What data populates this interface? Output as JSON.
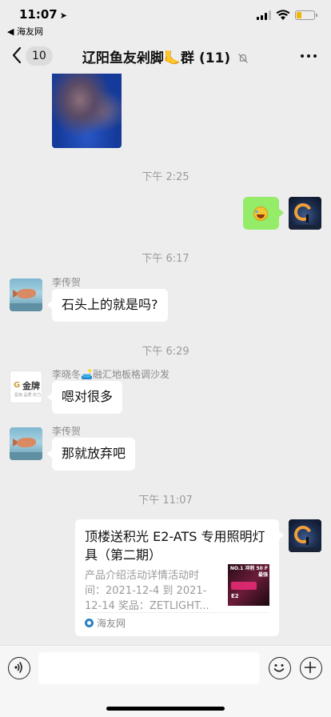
{
  "status_bar": {
    "time": "11:07",
    "back_app": "◀ 海友网",
    "battery_level": 0.28,
    "battery_color": "#f2b600"
  },
  "nav": {
    "back_count": "10",
    "title": "辽阳鱼友剁脚🦶群 (11)",
    "muted": true
  },
  "messages": [
    {
      "type": "image",
      "side": "left"
    },
    {
      "type": "timestamp",
      "text": "下午 2:25"
    },
    {
      "type": "emoji",
      "side": "right",
      "emoji": "laughing-tears-icon"
    },
    {
      "type": "timestamp",
      "text": "下午 6:17"
    },
    {
      "type": "text",
      "side": "left",
      "sender": "李传贺",
      "text": "石头上的就是吗?"
    },
    {
      "type": "timestamp",
      "text": "下午 6:29"
    },
    {
      "type": "text",
      "side": "left",
      "sender": "李晓冬🛋️融汇地板格调沙发",
      "text": "嗯对很多"
    },
    {
      "type": "text",
      "side": "left",
      "sender": "李传贺",
      "text": "那就放弃吧"
    },
    {
      "type": "timestamp",
      "text": "下午 11:07"
    },
    {
      "type": "link_card",
      "side": "right",
      "title": "顶楼送积光 E2-ATS 专用照明灯具（第二期）",
      "description": "产品介绍活动详情活动时间：2021-12-4 到 2021-12-14 奖品：ZETLIGHT...",
      "source": "海友网",
      "thumb_text_top": "NO.1 冲刺 50 F 最强",
      "thumb_text_bottom": "E2"
    }
  ],
  "avatar_logo": {
    "mark": "G",
    "brand": "金牌",
    "sub": "星级·品质·实力"
  },
  "colors": {
    "chat_bg": "#ededed",
    "bubble_self": "#95ec69",
    "bubble_other": "#ffffff",
    "timestamp": "#9b9b9b"
  }
}
